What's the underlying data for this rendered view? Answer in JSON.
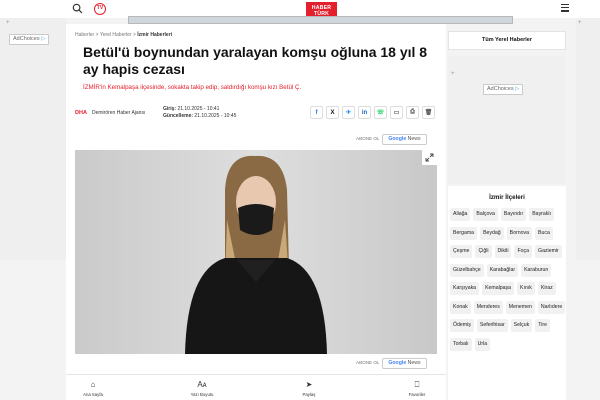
{
  "header": {
    "logo_line1": "HABER",
    "logo_line2": "TÜRK",
    "tv_label": "TV"
  },
  "ads": {
    "adchoices_label": "AdChoices"
  },
  "breadcrumb": {
    "items": [
      "Haberler",
      "Yerel Haberler",
      "İzmir Haberleri"
    ],
    "separator": ">"
  },
  "article": {
    "title": "Betül'ü boynundan yaralayan komşu oğluna 18 yıl 8 ay hapis cezası",
    "spot": "İZMİR'in Kemalpaşa ilçesinde, sokakta takip edip, saldırdığı komşu kızı Betül Ç.",
    "source_logo": "DHA",
    "source_name": "Demirören Haber Ajansı",
    "published_label": "Giriş:",
    "published": "21.10.2025 - 10:41",
    "updated_label": "Güncelleme:",
    "updated": "21.10.2025 - 10:45",
    "follow_label": "ABONE OL",
    "google_news_g": "Google",
    "google_news_n": " News"
  },
  "share": {
    "icons": [
      "facebook-icon",
      "x-icon",
      "bluesky-icon",
      "linkedin-icon",
      "whatsapp-icon",
      "comment-icon",
      "print-icon",
      "trash-icon"
    ],
    "glyphs": [
      "f",
      "X",
      "✈",
      "in",
      "☏",
      "▭",
      "⎙",
      "🗑"
    ]
  },
  "bottom_nav": [
    {
      "label": "Ana Sayfa",
      "icon": "home-icon"
    },
    {
      "label": "Yazı Boyutu",
      "icon": "font-size-icon"
    },
    {
      "label": "Paylaş",
      "icon": "share-icon"
    },
    {
      "label": "Favoriler",
      "icon": "bookmark-icon"
    }
  ],
  "sidebar": {
    "local_news_title": "Tüm Yerel Haberler",
    "districts_title": "İzmir İlçeleri",
    "districts": [
      "Aliağa",
      "Balçova",
      "Bayındır",
      "Bayraklı",
      "Bergama",
      "Beydağ",
      "Bornova",
      "Buca",
      "Çeşme",
      "Çiğli",
      "Dikili",
      "Foça",
      "Gaziemir",
      "Güzelbahçe",
      "Karabağlar",
      "Karaburun",
      "Karşıyaka",
      "Kemalpaşa",
      "Kınık",
      "Kiraz",
      "Konak",
      "Menderes",
      "Menemen",
      "Narlıdere",
      "Ödemiş",
      "Seferihisar",
      "Selçuk",
      "Tire",
      "Torbalı",
      "Urla"
    ]
  },
  "colors": {
    "brand_red": "#e3202b",
    "google_blue": "#4285f4"
  }
}
